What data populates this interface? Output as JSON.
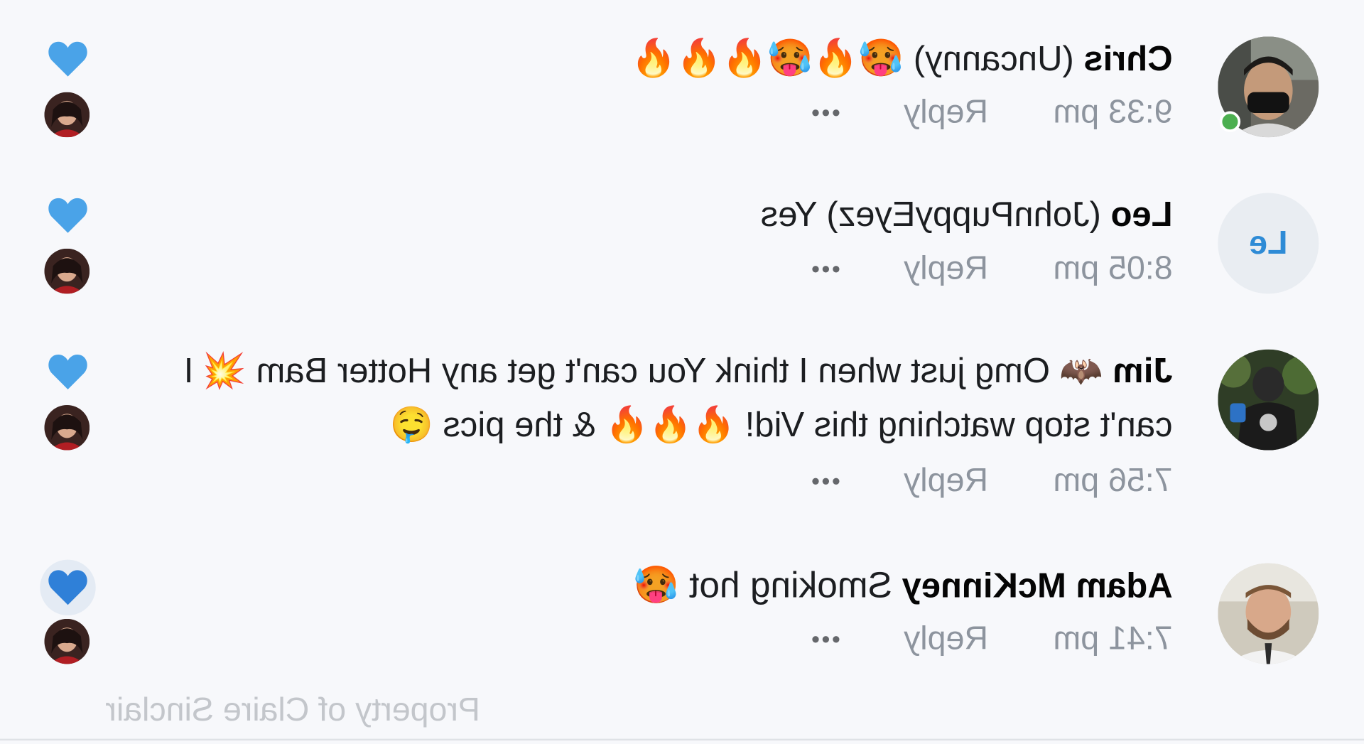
{
  "comments": [
    {
      "author": "Chris",
      "handle": "(Uncanny)",
      "text": "🥵🔥🥵🔥🔥🔥",
      "time": "9:33 pm",
      "reply_label": "Reply",
      "more_label": "•••",
      "author_online": true
    },
    {
      "author": "Leo",
      "handle": "(JohnPuppyEyez)",
      "text": "Yes",
      "initials": "Le",
      "time": "8:05 pm",
      "reply_label": "Reply",
      "more_label": "•••"
    },
    {
      "author": "Jim",
      "text": "🦇 Omg just when I think You can't get any Hotter Bam 💥 I can't stop watching this Vid! 🔥🔥🔥 & the pics 🤤",
      "time": "7:56 pm",
      "reply_label": "Reply",
      "more_label": "•••"
    },
    {
      "author": "Adam McKinney",
      "text": "Smoking hot 🥵",
      "time": "7:41 pm",
      "reply_label": "Reply",
      "more_label": "•••"
    }
  ],
  "watermark": "Property of Claire Sinclair",
  "colors": {
    "heart": "#4aa3e8",
    "heart_active": "#2f80d8",
    "online": "#4caf50",
    "initials_text": "#2e8bd6",
    "meta_text": "#8d949e"
  },
  "icons": {
    "like": "heart-icon",
    "more": "more-dots-icon"
  }
}
